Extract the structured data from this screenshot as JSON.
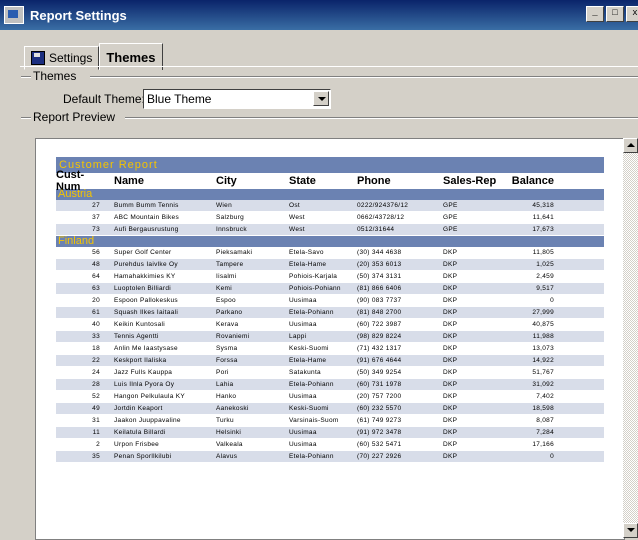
{
  "window": {
    "title": "Report Settings",
    "buttons": [
      "_",
      "□",
      "x"
    ]
  },
  "tabs": [
    {
      "label": "Settings"
    },
    {
      "label": "Themes"
    }
  ],
  "themes_group": {
    "label": "Themes",
    "default_theme_label": "Default Theme:",
    "default_theme_value": "Blue Theme"
  },
  "preview_group": {
    "label": "Report Preview"
  },
  "report": {
    "title": "Customer Report",
    "columns": [
      "Cust-Num",
      "Name",
      "City",
      "State",
      "Phone",
      "Sales-Rep",
      "Balance"
    ],
    "groups": [
      {
        "name": "Austria",
        "rows": [
          [
            "27",
            "Bumm Bumm Tennis",
            "Wien",
            "Ost",
            "0222/924376/12",
            "GPE",
            "45,318"
          ],
          [
            "37",
            "ABC Mountain Bikes",
            "Salzburg",
            "West",
            "0662/43728/12",
            "GPE",
            "11,641"
          ],
          [
            "73",
            "Aufi Bergausrustung",
            "Innsbruck",
            "West",
            "0512/31644",
            "GPE",
            "17,673"
          ]
        ]
      },
      {
        "name": "Finland",
        "rows": [
          [
            "56",
            "Super Golf Center",
            "Pieksamaki",
            "Etela-Savo",
            "(30) 344 4638",
            "DKP",
            "11,805"
          ],
          [
            "48",
            "Purehdus Iaivlke Oy",
            "Tampere",
            "Etela-Hame",
            "(20) 353 6013",
            "DKP",
            "1,025"
          ],
          [
            "64",
            "Hamahakkimies KY",
            "Iisalmi",
            "Pohiois-Karjala",
            "(50) 374 3131",
            "DKP",
            "2,459"
          ],
          [
            "63",
            "Luoptolen Billiardi",
            "Kemi",
            "Pohiois-Pohiann",
            "(81) 866 6406",
            "DKP",
            "9,517"
          ],
          [
            "20",
            "Espoon Pallokeskus",
            "Espoo",
            "Uusimaa",
            "(90) 083 7737",
            "DKP",
            "0"
          ],
          [
            "61",
            "Squash Ilkes Iaitaali",
            "Parkano",
            "Etela-Pohiann",
            "(81) 848 2700",
            "DKP",
            "27,999"
          ],
          [
            "40",
            "Keikin Kuntosali",
            "Kerava",
            "Uusimaa",
            "(60) 722 3987",
            "DKP",
            "40,875"
          ],
          [
            "33",
            "Tennis Agentti",
            "Rovaniemi",
            "Lappi",
            "(98) 829 8224",
            "DKP",
            "11,988"
          ],
          [
            "18",
            "Anlin Me Iaastysase",
            "Sysma",
            "Keski-Suomi",
            "(71) 432 1317",
            "DKP",
            "13,073"
          ],
          [
            "22",
            "Keskport Ilaliska",
            "Forssa",
            "Etela-Hame",
            "(91) 676 4644",
            "DKP",
            "14,922"
          ],
          [
            "24",
            "Jazz Fulls Kauppa",
            "Pori",
            "Satakunta",
            "(50) 349 9254",
            "DKP",
            "51,767"
          ],
          [
            "28",
            "Luis Ilnla Pyora Oy",
            "Lahia",
            "Etela-Pohiann",
            "(60) 731 1978",
            "DKP",
            "31,092"
          ],
          [
            "52",
            "Hangon Pelkulaula KY",
            "Hanko",
            "Uusimaa",
            "(20) 757 7200",
            "DKP",
            "7,402"
          ],
          [
            "49",
            "Jortdin Keaport",
            "Aanekoski",
            "Keski-Suomi",
            "(60) 232 5570",
            "DKP",
            "18,598"
          ],
          [
            "31",
            "Jaakon Juuppavaline",
            "Turku",
            "Varsinais-Suom",
            "(61) 749 9273",
            "DKP",
            "8,087"
          ],
          [
            "11",
            "Keilatula Billardi",
            "Helsinki",
            "Uusimaa",
            "(91) 972 3478",
            "DKP",
            "7,284"
          ],
          [
            "2",
            "Urpon Frisbee",
            "Valkeala",
            "Uusimaa",
            "(60) 532 5471",
            "DKP",
            "17,166"
          ],
          [
            "35",
            "Penan Sporllkilubi",
            "Alavus",
            "Etela-Pohiann",
            "(70) 227 2926",
            "DKP",
            "0"
          ]
        ]
      }
    ]
  }
}
